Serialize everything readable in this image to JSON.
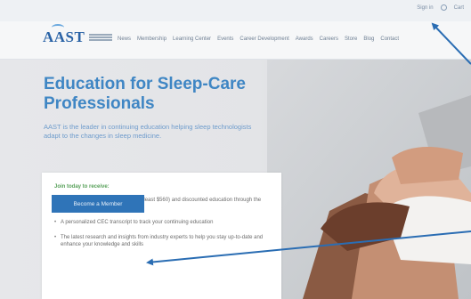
{
  "utility_bar": {
    "links": [
      "Sign in",
      "Q",
      "Cart"
    ]
  },
  "header": {
    "logo_text": "AAST",
    "nav_items": [
      "News",
      "Membership",
      "Learning Center",
      "Events",
      "Career Development",
      "Awards",
      "Careers",
      "Store",
      "Blog",
      "Contact"
    ]
  },
  "hero": {
    "headline": "Education for Sleep-Care Professionals",
    "subtext": "AAST is the leader in continuing education helping sleep technologists adapt to the changes in sleep medicine."
  },
  "card": {
    "title": "Join today to receive:",
    "bullets": [
      "Access to free CECs (a value of at least $560) and discounted education through the AAST Learning Center",
      "A personalized CEC transcript to track your continuing education",
      "The latest research and insights from industry experts to help you stay up-to-date and enhance your knowledge and skills"
    ],
    "cta_label": "Become a Member"
  },
  "colors": {
    "brand_blue": "#2f74b8",
    "headline_blue": "#3f86c4",
    "card_title_green": "#58a15a",
    "arrow_blue": "#2a6db3"
  }
}
